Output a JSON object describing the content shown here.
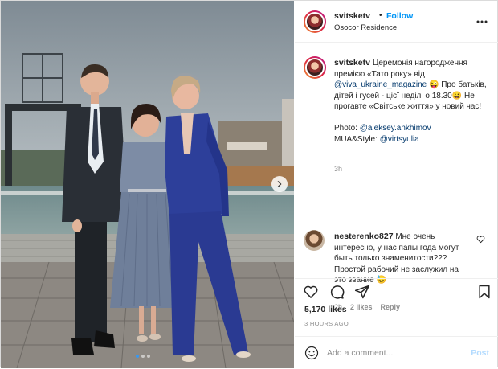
{
  "post": {
    "username": "svitsketv",
    "follow_label": "Follow",
    "bullet": "•",
    "location": "Osocor Residence",
    "caption": {
      "username": "svitsketv",
      "text_1": "Церемонія нагородження премією «Тато року» від ",
      "mention_1": "@viva_ukraine_magazine",
      "text_2": " 😜 Про батьків, дітей і гусей - цієї неділі о 18.30😀 Не прогавте «Світське життя» у новий час!",
      "photo_label": "Photo: ",
      "mention_2": "@aleksey.ankhimov",
      "mua_label": "MUA&Style: ",
      "mention_3": "@virtsyulia",
      "time": "3h"
    },
    "comment": {
      "username": "nesterenko827",
      "text": "Мне очень интересно, у нас папы года могут быть только знаменитости??? Простой рабочий не заслужил на это звание 😓",
      "time": "2h",
      "likes": "2 likes",
      "reply_label": "Reply"
    },
    "likes_count": "5,170 likes",
    "time_ago": "3 HOURS AGO",
    "add_comment_placeholder": "Add a comment...",
    "post_label": "Post",
    "carousel": {
      "total": 3,
      "active": 1
    }
  },
  "colors": {
    "link_blue": "#0095f6",
    "mention": "#00376b",
    "muted": "#8e8e8e",
    "post_disabled": "#b3dbff",
    "dress_blue": "#2d3f9a"
  },
  "icons": [
    "more-icon",
    "heart-icon",
    "comment-icon",
    "share-icon",
    "bookmark-icon",
    "emoji-icon",
    "chevron-right-icon",
    "heart-small-icon"
  ]
}
